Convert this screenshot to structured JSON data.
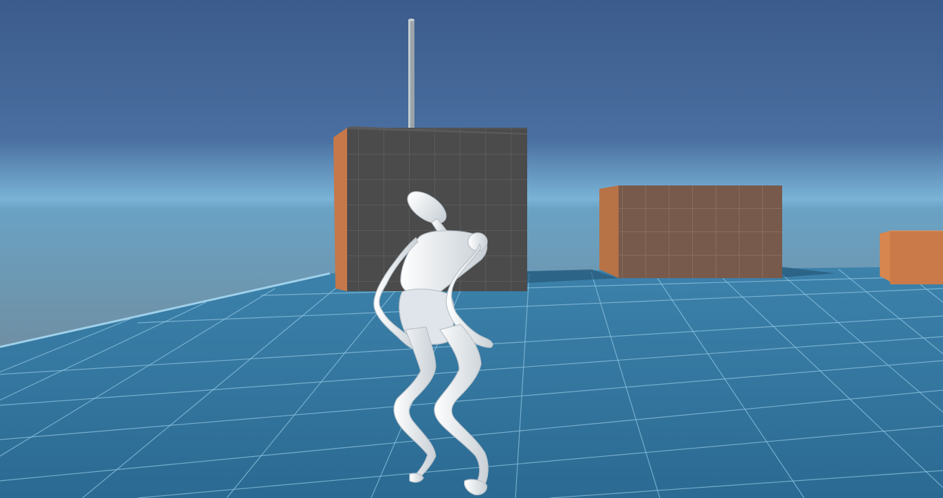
{
  "scene": {
    "type": "3d-game-viewport",
    "sky_top_color": "#3b5b8c",
    "sky_horizon_color": "#79b3d6",
    "floor_color": "#2f6f96",
    "floor_grid_color": "#8ec3e0",
    "wall_block_front_color": "#4a4a4a",
    "wall_block_side_color": "#c6784a",
    "box_color": "#a8724f",
    "character_color": "#e6eaee",
    "pole_color": "#9aa4aa"
  }
}
